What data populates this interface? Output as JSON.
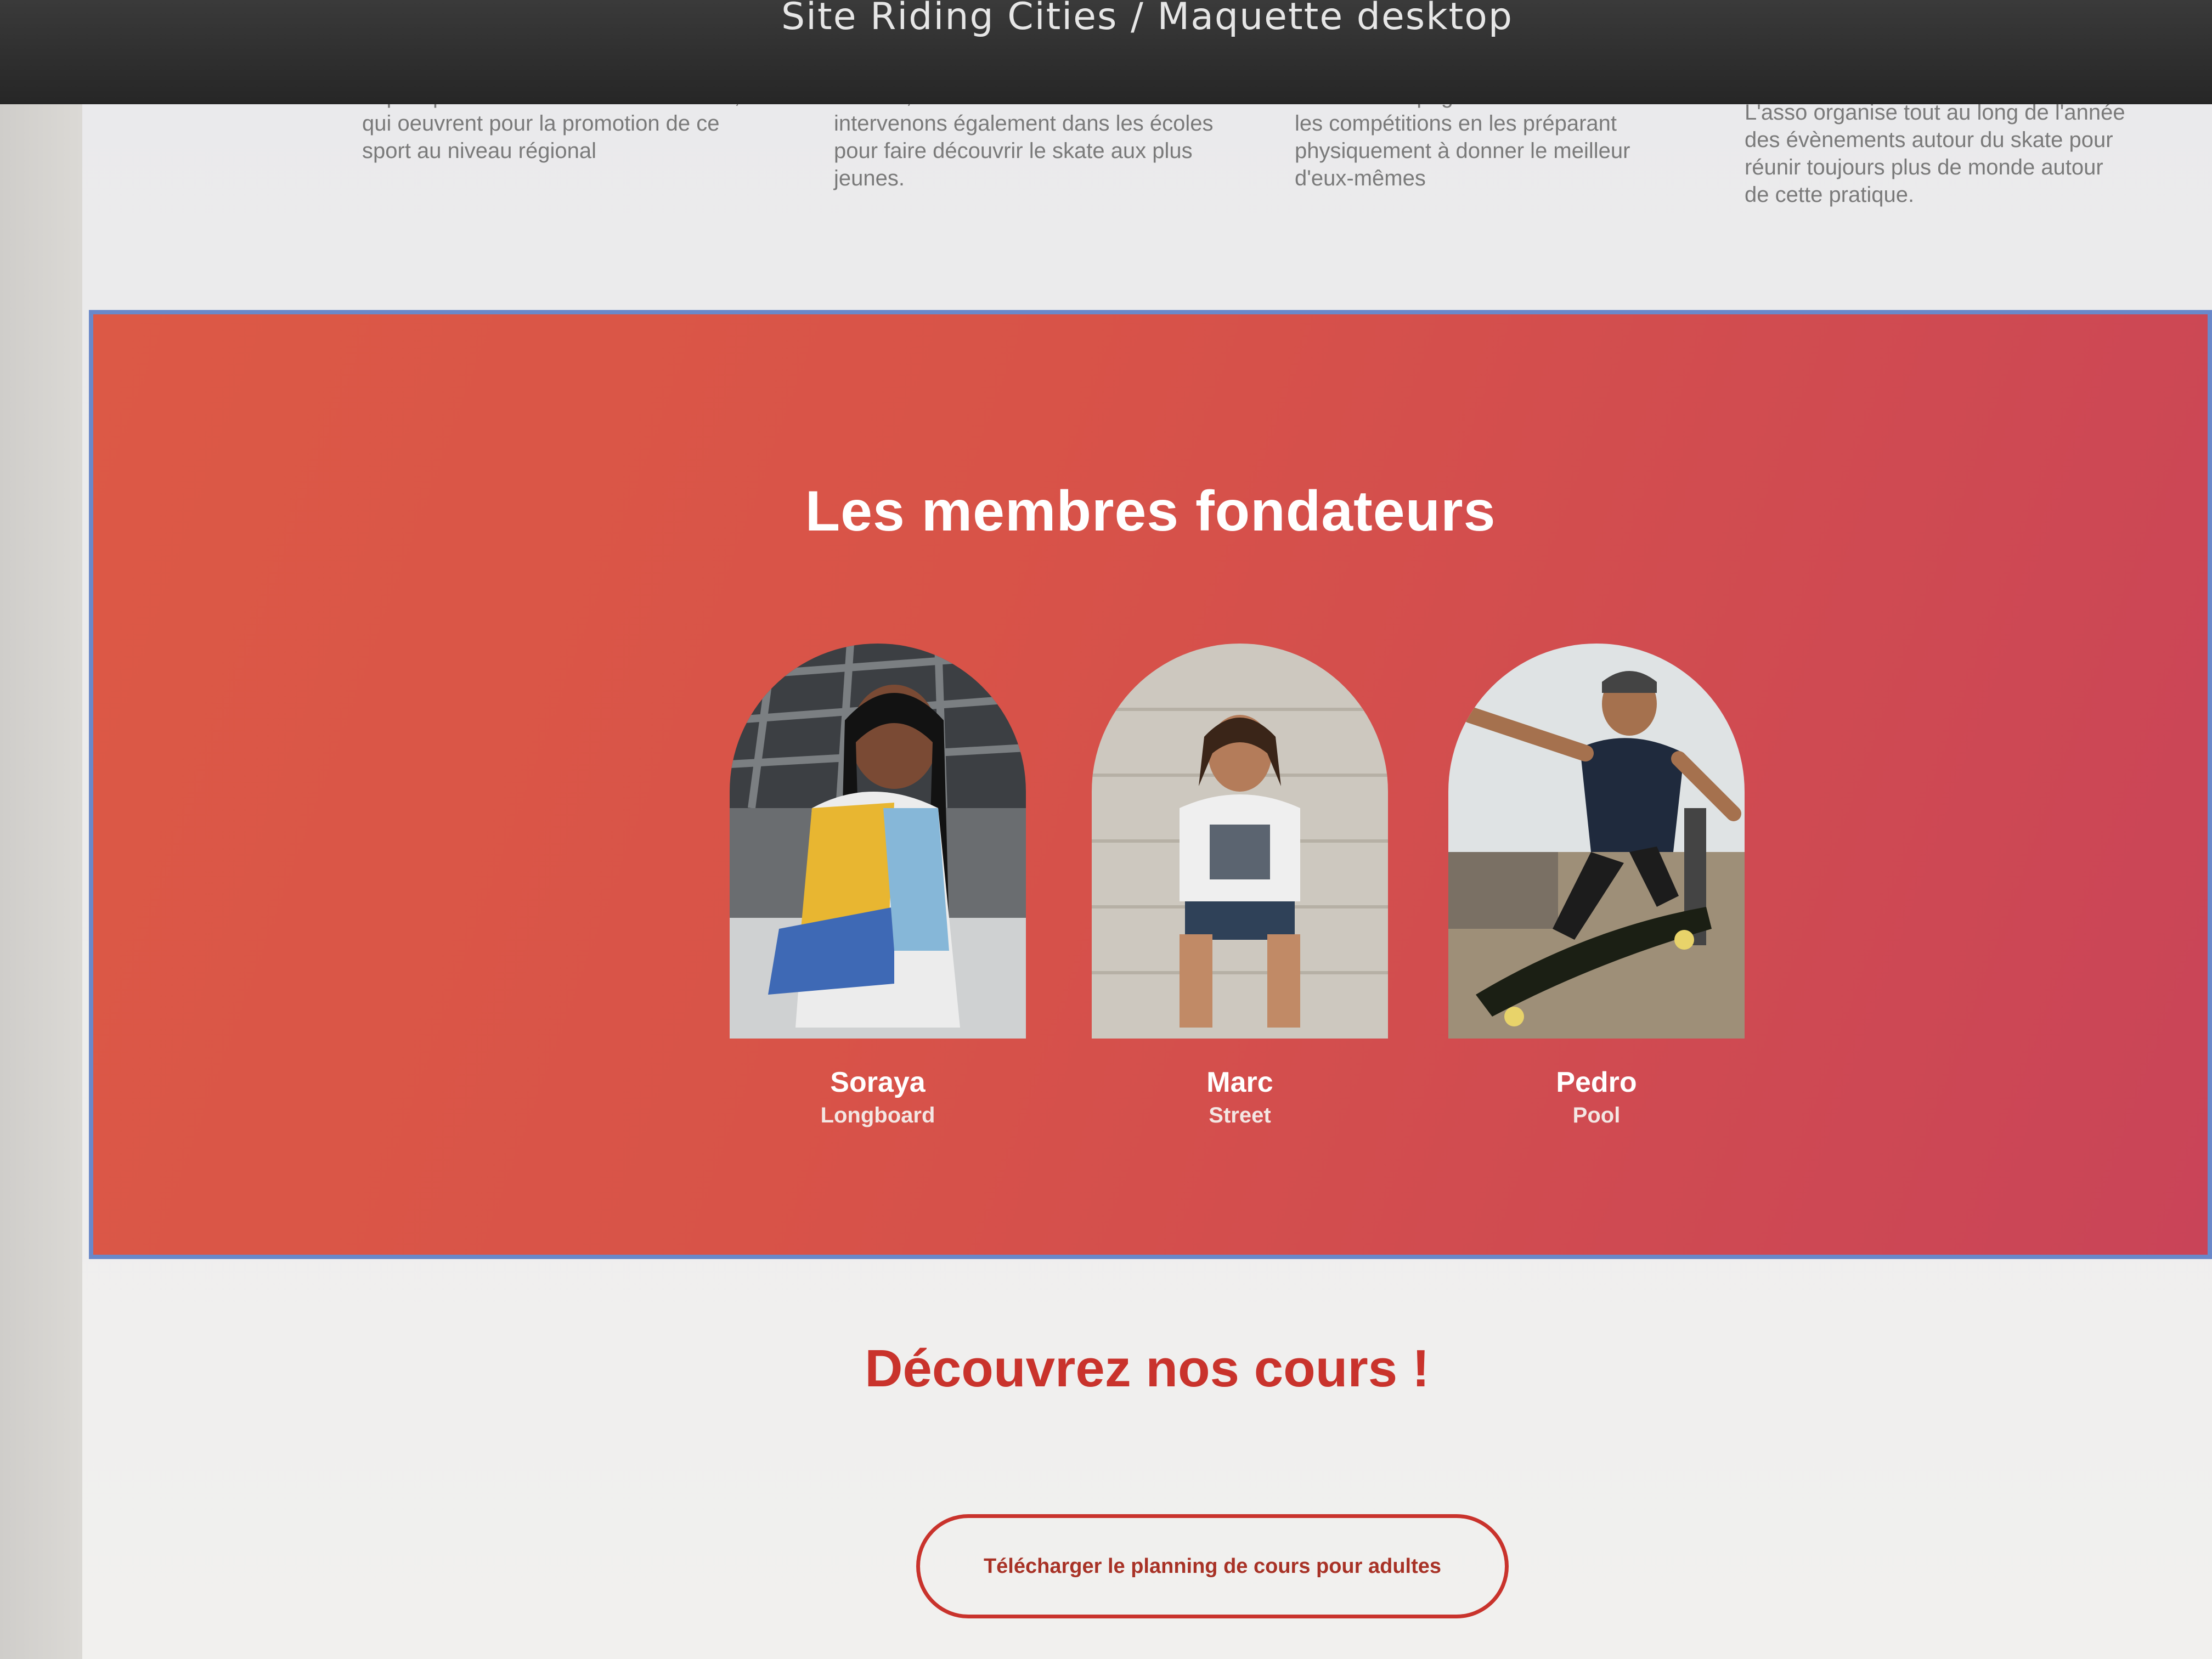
{
  "window": {
    "title": "Site Riding Cities / Maquette desktop"
  },
  "services": [
    {
      "text": "L'association est passionnée de glisse, et plus particulièrement de skateboard, qui oeuvrent pour la promotion de ce sport au niveau régional"
    },
    {
      "text": "Nous proposons des cours pour enfants, ados et adultes. Nous intervenons également dans les écoles pour faire découvrir le skate aux plus jeunes."
    },
    {
      "text": "Nous accompagnons nos membres sur les compétitions en les préparant physiquement à donner le meilleur d'eux-mêmes"
    },
    {
      "text": "L'asso organise tout au long de l'année des évènements autour du skate pour réunir toujours plus de monde autour de cette pratique."
    }
  ],
  "founders": {
    "title": "Les membres fondateurs",
    "members": [
      {
        "name": "Soraya",
        "discipline": "Longboard"
      },
      {
        "name": "Marc",
        "discipline": "Street"
      },
      {
        "name": "Pedro",
        "discipline": "Pool"
      }
    ]
  },
  "courses": {
    "title": "Découvrez nos cours !",
    "button_label": "Télécharger le planning de cours pour adultes"
  },
  "colors": {
    "accent_red": "#c9332c",
    "founders_bg_start": "#dc5946",
    "founders_bg_end": "#c94458",
    "frame_blue": "#6a88c9"
  }
}
